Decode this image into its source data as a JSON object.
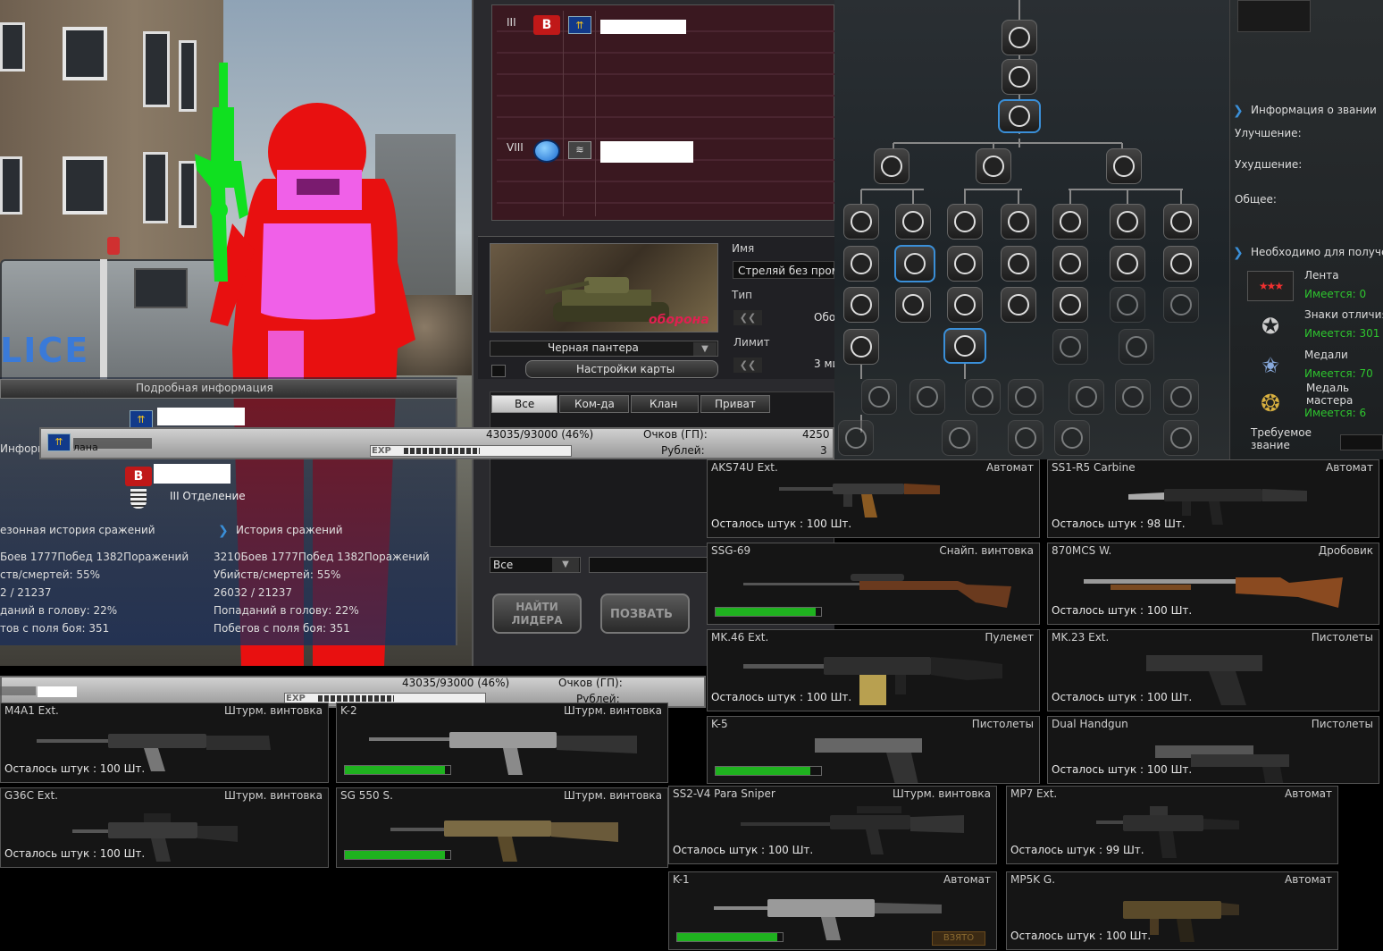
{
  "character_panel": {
    "detail_header": "Подробная информация",
    "info_label": "Информ",
    "clan_label": "лана",
    "squad_label": "III Отделение",
    "season_history_title": "езонная история сражений",
    "history_title": "История сражений",
    "season_stats": [
      "Боев 1777Побед 1382Поражений",
      "ств/смертей: 55%",
      "2 / 21237",
      "даний в голову: 22%",
      "тов с поля боя: 351"
    ],
    "history_stats": [
      "3210Боев 1777Побед 1382Поражений",
      "Убийств/смертей: 55%",
      "26032 / 21237",
      "Попаданий в голову: 22%",
      "Побегов с поля боя: 351"
    ]
  },
  "exp_bar_top": {
    "exp_text": "43035/93000 (46%)",
    "points_label": "Очков (ГП):",
    "points_value": "4250",
    "rubles_label": "Рублей:",
    "rubles_value": "3",
    "exp_label": "EXP",
    "progress": 0.46
  },
  "exp_bar_bottom": {
    "exp_text": "43035/93000 (46%)",
    "points_label": "Очков (ГП):",
    "rubles_label": "Рублей:",
    "exp_label": "EXP",
    "progress": 0.46
  },
  "lobby": {
    "squad_rows": [
      "III",
      "VIII"
    ],
    "map_name": "Черная пантера",
    "map_overlay": "оборона",
    "map_settings_button": "Настройки карты",
    "name_label": "Имя",
    "room_name": "Стреляй без прома",
    "type_label": "Тип",
    "type_value": "Обо",
    "limit_label": "Лимит",
    "limit_value": "3 ми",
    "tabs": [
      "Все",
      "Ком-да",
      "Клан",
      "Приват"
    ],
    "filter_value": "Все",
    "find_leader_button": "НАЙТИ ЛИДЕРА",
    "invite_button": "ПОЗВАТЬ"
  },
  "rank_panel": {
    "rank_info_title": "Информация о звании",
    "upgrade_label": "Улучшение:",
    "downgrade_label": "Ухудшение:",
    "total_label": "Общее:",
    "requirements_title": "Необходимо для получен",
    "requirements": [
      {
        "name": "Лента",
        "have": "Имеется: 0"
      },
      {
        "name": "Знаки отличия",
        "have": "Имеется: 301"
      },
      {
        "name": "Медали",
        "have": "Имеется: 70"
      },
      {
        "name": "Медаль мастера",
        "have": "Имеется: 6"
      }
    ],
    "required_rank_label": "Требуемое звание"
  },
  "weapons_right": [
    {
      "name": "AKS74U Ext.",
      "type": "Автомат",
      "qty": "Осталось штук : 100 Шт."
    },
    {
      "name": "SS1-R5 Carbine",
      "type": "Автомат",
      "qty": "Осталось штук : 98 Шт."
    },
    {
      "name": "SSG-69",
      "type": "Снайп. винтовка",
      "progress": 0.95
    },
    {
      "name": "870MCS W.",
      "type": "Дробовик",
      "qty": "Осталось штук : 100 Шт."
    },
    {
      "name": "MK.46 Ext.",
      "type": "Пулемет",
      "qty": "Осталось штук : 100 Шт."
    },
    {
      "name": "MK.23 Ext.",
      "type": "Пистолеты",
      "qty": "Осталось штук : 100 Шт."
    },
    {
      "name": "K-5",
      "type": "Пистолеты",
      "progress": 0.9
    },
    {
      "name": "Dual Handgun",
      "type": "Пистолеты",
      "qty": "Осталось штук : 100 Шт."
    }
  ],
  "weapons_left": [
    {
      "name": "M4A1 Ext.",
      "type": "Штурм. винтовка",
      "qty": "Осталось штук : 100 Шт."
    },
    {
      "name": "K-2",
      "type": "Штурм. винтовка",
      "progress": 0.95
    },
    {
      "name": "G36C Ext.",
      "type": "Штурм. винтовка",
      "qty": "Осталось штук : 100 Шт."
    },
    {
      "name": "SG 550 S.",
      "type": "Штурм. винтовка",
      "progress": 0.95
    }
  ],
  "weapons_bottom": [
    {
      "name": "SS2-V4 Para Sniper",
      "type": "Штурм. винтовка",
      "qty": "Осталось штук : 100 Шт."
    },
    {
      "name": "MP7 Ext.",
      "type": "Автомат",
      "qty": "Осталось штук : 99 Шт."
    },
    {
      "name": "K-1",
      "type": "Автомат",
      "progress": 0.95,
      "button": "ВЗЯТО"
    },
    {
      "name": "MP5K G.",
      "type": "Автомат",
      "qty": "Осталось штук : 100 Шт."
    }
  ],
  "colors": {
    "accent_blue": "#3a8fd8",
    "progress_green": "#1fb21f",
    "character_red": "#e81010",
    "character_pink": "#f060e8",
    "rifle_green": "#10e020"
  }
}
